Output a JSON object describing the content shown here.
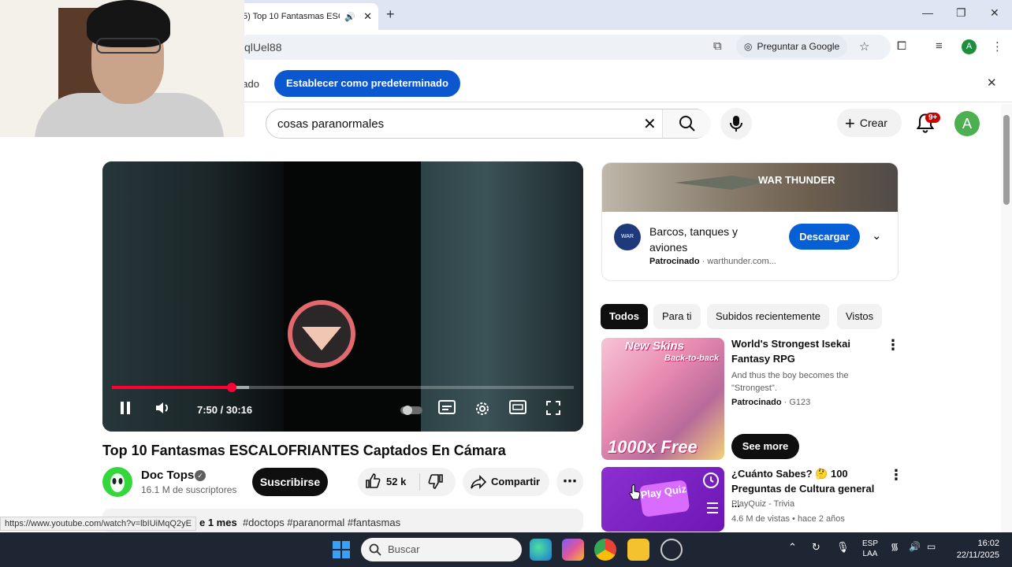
{
  "browser": {
    "tab_title": "5) Top 10 Fantasmas ESC",
    "address_text": "qlUel88",
    "ask_google_label": "Preguntar a Google",
    "profile_letter": "A",
    "infobar_text": "nado",
    "infobar_button": "Establecer como predeterminado"
  },
  "youtube": {
    "search_query": "cosas paranormales",
    "create_label": "Crear",
    "notifications_count": "9+",
    "account_letter": "A"
  },
  "player": {
    "time": "7:50 / 30:16",
    "progress_fraction": 0.259,
    "buffered_fraction": 0.297
  },
  "video": {
    "title": "Top 10 Fantasmas ESCALOFRIANTES Captados En Cámara",
    "channel": "Doc Tops",
    "subscribers": "16.1 M de suscriptores",
    "subscribe_label": "Suscribirse",
    "likes": "52 k",
    "share_label": "Compartir",
    "desc_time": "e 1 mes",
    "desc_tags": "#doctops #paranormal #fantasmas",
    "status_url": "https://www.youtube.com/watch?v=lbIUiMqQ2yE"
  },
  "ad": {
    "banner_logo": "WAR THUNDER",
    "icon_label": "WAR THUNDER",
    "title": "Barcos, tanques y aviones",
    "sponsored": "Patrocinado",
    "domain": "warthunder.com...",
    "button": "Descargar"
  },
  "chips": [
    "Todos",
    "Para ti",
    "Subidos recientemente",
    "Vistos"
  ],
  "recommendations": [
    {
      "thumb_top": "New Skins",
      "thumb_sub": "Back-to-back",
      "thumb_bottom": "1000x Free",
      "title": "World's Strongest Isekai Fantasy RPG",
      "desc": "And thus the boy becomes the \"Strongest\".",
      "sponsored": "Patrocinado",
      "advertiser": "G123",
      "cta": "See more"
    },
    {
      "thumb_text": "Play Quiz",
      "title": "¿Cuánto Sabes? 🤔 100 Preguntas de Cultura general ...",
      "channel": "PlayQuiz - Trivia",
      "meta": "4.6 M de vistas • hace 2 años"
    }
  ],
  "taskbar": {
    "search_placeholder": "Buscar",
    "lang_top": "ESP",
    "lang_bottom": "LAA",
    "time": "16:02",
    "date": "22/11/2025"
  },
  "colors": {
    "yt_red": "#ff0033",
    "chrome_blue": "#0b57d0",
    "ad_blue": "#065fd4",
    "taskbar": "#1f2633"
  }
}
